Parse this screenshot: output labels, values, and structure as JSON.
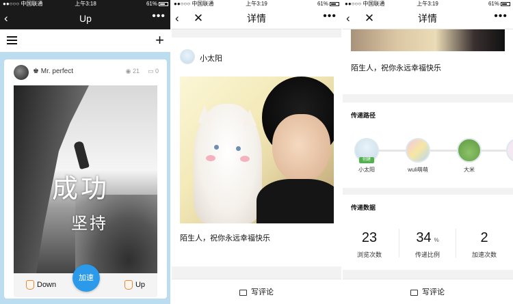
{
  "panel1": {
    "status": {
      "carrier": "●●○○○ 中国联通",
      "time": "上午3:18",
      "battery": "61%"
    },
    "nav": {
      "back_icon": "chevron-left-icon",
      "title": "Up",
      "more": "•••"
    },
    "toolbar": {
      "menu_icon": "hamburger-menu-icon",
      "add_icon": "plus-icon",
      "add_symbol": "+"
    },
    "card": {
      "username": "Mr. perfect",
      "views": "21",
      "comments": "0",
      "image_text_line1": "成功",
      "image_text_line2": "坚持",
      "down_label": "Down",
      "accelerate_label": "加速",
      "up_label": "Up"
    }
  },
  "panel2": {
    "status": {
      "carrier": "●●○○○ 中国联通",
      "time": "上午3:19",
      "battery": "61%"
    },
    "nav": {
      "title": "详情",
      "more": "•••"
    },
    "post": {
      "username": "小太阳",
      "caption": "陌生人，祝你永远幸福快乐"
    },
    "comment_label": "写评论"
  },
  "panel3": {
    "status": {
      "carrier": "●●○○○ 中国联通",
      "time": "上午3:19",
      "battery": "61%"
    },
    "nav": {
      "title": "详情",
      "more": "•••"
    },
    "caption": "陌生人，祝你永远幸福快乐",
    "path": {
      "title": "传递路径",
      "created_badge": "创建",
      "nodes": [
        {
          "name": "小太阳"
        },
        {
          "name": "wuli萌萌"
        },
        {
          "name": "大米"
        }
      ]
    },
    "data_section": {
      "title": "传递数据",
      "stats": [
        {
          "value": "23",
          "unit": "",
          "label": "浏览次数"
        },
        {
          "value": "34",
          "unit": "%",
          "label": "传递比例"
        },
        {
          "value": "2",
          "unit": "",
          "label": "加速次数"
        }
      ]
    },
    "comment_label": "写评论"
  },
  "colors": {
    "accent_blue": "#2c9aea",
    "panel1_bg": "#bcdcf0",
    "created_green": "#4fb24f"
  }
}
